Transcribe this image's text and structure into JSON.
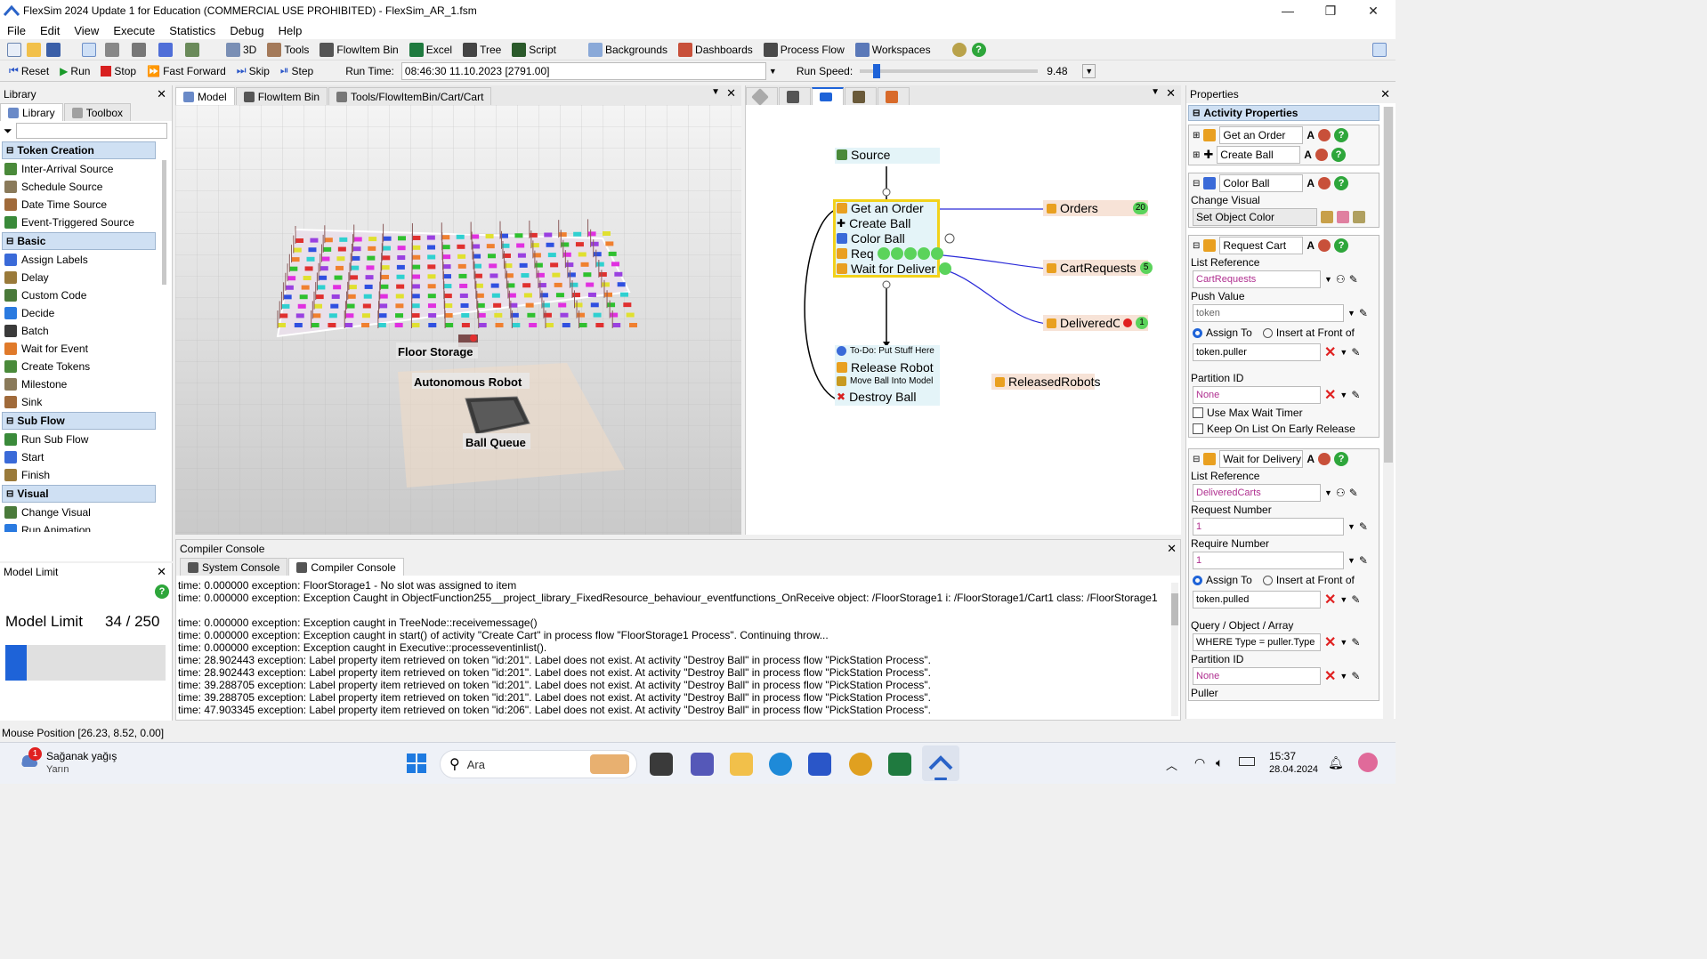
{
  "window": {
    "title": "FlexSim 2024 Update 1 for Education (COMMERCIAL USE PROHIBITED) - FlexSim_AR_1.fsm"
  },
  "menu": [
    "File",
    "Edit",
    "View",
    "Execute",
    "Statistics",
    "Debug",
    "Help"
  ],
  "toolbar": {
    "items": [
      "3D",
      "Tools",
      "FlowItem Bin",
      "Excel",
      "Tree",
      "Script",
      "Backgrounds",
      "Dashboards",
      "Process Flow",
      "Workspaces"
    ]
  },
  "runbar": {
    "reset": "Reset",
    "run": "Run",
    "stop": "Stop",
    "fast_forward": "Fast Forward",
    "skip": "Skip",
    "step": "Step",
    "run_time_label": "Run Time:",
    "run_time": "08:46:30  11.10.2023  [2791.00]",
    "run_speed_label": "Run Speed:",
    "run_speed": "9.48"
  },
  "library": {
    "title": "Library",
    "tabs": [
      "Library",
      "Toolbox"
    ],
    "categories": [
      {
        "name": "Token Creation",
        "items": [
          "Inter-Arrival Source",
          "Schedule Source",
          "Date Time Source",
          "Event-Triggered Source"
        ]
      },
      {
        "name": "Basic",
        "items": [
          "Assign Labels",
          "Delay",
          "Custom Code",
          "Decide",
          "Batch",
          "Wait for Event",
          "Create Tokens",
          "Milestone",
          "Sink"
        ]
      },
      {
        "name": "Sub Flow",
        "items": [
          "Run Sub Flow",
          "Start",
          "Finish"
        ]
      },
      {
        "name": "Visual",
        "items": [
          "Change Visual",
          "Run Animation",
          "Create Kinematics"
        ]
      }
    ]
  },
  "model_limit": {
    "title": "Model Limit",
    "label": "Model Limit",
    "value": "34 / 250",
    "fraction": 0.136
  },
  "model_view": {
    "tabs": [
      "Model",
      "FlowItem Bin",
      "Tools/FlowItemBin/Cart/Cart"
    ],
    "labels": [
      "Floor Storage",
      "Autonomous Robot",
      "Ball Queue"
    ]
  },
  "process_flow": {
    "source": "Source",
    "activities": [
      "Get an Order",
      "Create Ball",
      "Color Ball",
      "Req",
      "Wait for Deliver"
    ],
    "lower": [
      "To-Do: Put Stuff Here",
      "Release Robot",
      "Move Ball Into Model",
      "Destroy Ball"
    ],
    "lists": [
      {
        "name": "Orders",
        "count": "20"
      },
      {
        "name": "CartRequests",
        "count": "5"
      },
      {
        "name": "DeliveredCa",
        "count": "1"
      },
      {
        "name": "ReleasedRobots",
        "count": ""
      }
    ]
  },
  "properties": {
    "title": "Properties",
    "section": "Activity Properties",
    "get_order": "Get an Order",
    "create_ball": "Create Ball",
    "color_ball": "Color Ball",
    "change_visual_label": "Change Visual",
    "change_visual_value": "Set Object Color",
    "request_cart": "Request Cart",
    "list_reference_label": "List Reference",
    "list_reference_value": "CartRequests",
    "push_value_label": "Push Value",
    "push_value": "token",
    "assign_to": "Assign To",
    "insert_front": "Insert at Front of",
    "assign_value": "token.puller",
    "partition_label": "Partition ID",
    "partition_value": "None",
    "use_max_wait": "Use Max Wait Timer",
    "keep_on_list": "Keep On List On Early Release",
    "wait_delivery": "Wait for Delivery",
    "list_reference2": "DeliveredCarts",
    "request_number_label": "Request Number",
    "request_number": "1",
    "require_number_label": "Require Number",
    "require_number": "1",
    "assign_value2": "token.pulled",
    "query_label": "Query / Object / Array",
    "query_value": "WHERE Type = puller.Type",
    "partition_value2": "None",
    "puller_label": "Puller"
  },
  "console": {
    "title": "Compiler Console",
    "tabs": [
      "System Console",
      "Compiler Console"
    ],
    "lines": [
      "time: 0.000000 exception: FloorStorage1 - No slot was assigned to item",
      "time: 0.000000 exception: Exception Caught in ObjectFunction255__project_library_FixedResource_behaviour_eventfunctions_OnReceive object: /FloorStorage1 i: /FloorStorage1/Cart1 class: /FloorStorage1",
      "",
      "time: 0.000000 exception: Exception caught in TreeNode::receivemessage()",
      "time: 0.000000 exception: Exception caught in start() of activity \"Create Cart\" in process flow \"FloorStorage1 Process\". Continuing throw...",
      "time: 0.000000 exception: Exception caught in Executive::processeventinlist().",
      "time: 28.902443 exception: Label property item retrieved on token \"id:201\". Label does not exist. At activity \"Destroy Ball\" in process flow \"PickStation Process\".",
      "time: 28.902443 exception: Label property item retrieved on token \"id:201\". Label does not exist. At activity \"Destroy Ball\" in process flow \"PickStation Process\".",
      "time: 39.288705 exception: Label property item retrieved on token \"id:201\". Label does not exist. At activity \"Destroy Ball\" in process flow \"PickStation Process\".",
      "time: 39.288705 exception: Label property item retrieved on token \"id:201\". Label does not exist. At activity \"Destroy Ball\" in process flow \"PickStation Process\".",
      "time: 47.903345 exception: Label property item retrieved on token \"id:206\". Label does not exist. At activity \"Destroy Ball\" in process flow \"PickStation Process\"."
    ]
  },
  "statusbar": {
    "mouse": "Mouse Position [26.23, 8.52, 0.00]"
  },
  "taskbar": {
    "weather": "Sağanak yağış",
    "weather_sub": "Yarın",
    "weather_badge": "1",
    "search": "Ara",
    "time": "15:37",
    "date": "28.04.2024"
  }
}
